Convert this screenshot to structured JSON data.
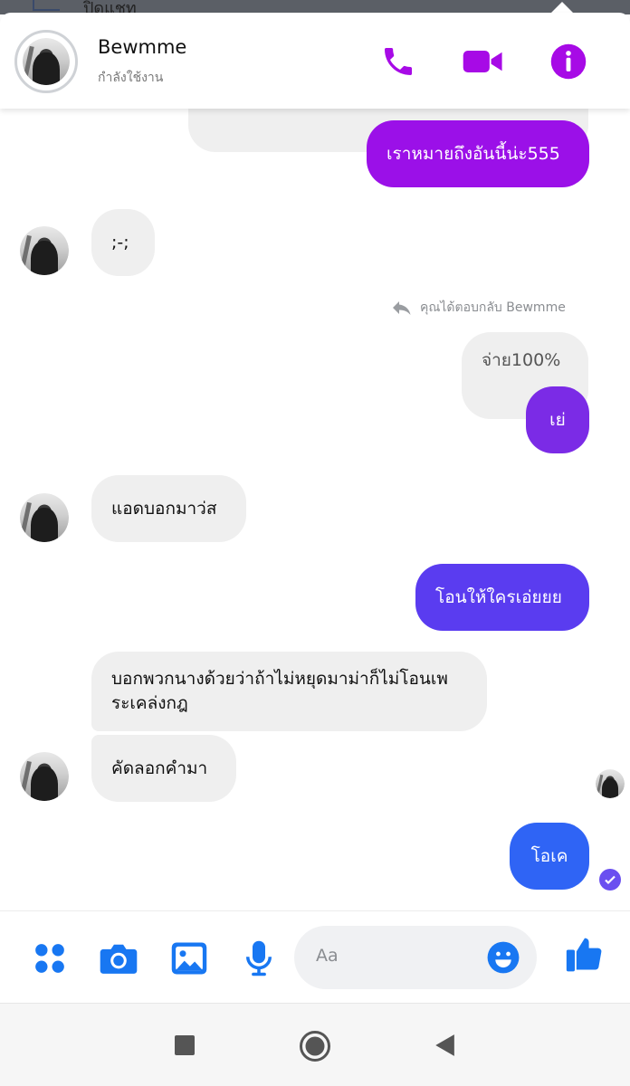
{
  "background": {
    "peek_text": "ปิดแชท"
  },
  "header": {
    "name": "Bewmme",
    "status": "กำลังใช้งาน",
    "accent": "#a70ae6",
    "actions": [
      "phone-icon",
      "video-icon",
      "info-icon"
    ]
  },
  "messages": [
    {
      "id": "m0",
      "side": "out",
      "text": "เราหมายถึงอันนี้น่ะ555",
      "color": "#9b10e8"
    },
    {
      "id": "m1",
      "side": "in",
      "text": ";-;"
    },
    {
      "id": "m2",
      "side": "in-reply",
      "text": "จ่าย100%"
    },
    {
      "id": "m3",
      "side": "out",
      "text": "เย่",
      "color": "#7b2be6"
    },
    {
      "id": "m4",
      "side": "in",
      "text": "แอดบอกมาว่ส"
    },
    {
      "id": "m5",
      "side": "out",
      "text": "โอนให้ใครเอ่ยยย",
      "color": "#5a3cf0"
    },
    {
      "id": "m6",
      "side": "in",
      "text_line1": "บอกพวกนางด้วยว่าถ้าไม่หยุดมาม่าก็ไม่โอนเพ",
      "text_line2": "ระเคล่งกฎ"
    },
    {
      "id": "m7",
      "side": "in",
      "text": "คัดลอกคำมา"
    },
    {
      "id": "m8",
      "side": "out",
      "text": "โอเค",
      "color": "#2f64f5"
    }
  ],
  "reply_note": {
    "text": "คุณได้ตอบกลับ Bewmme"
  },
  "composer": {
    "placeholder": "Aa",
    "accent": "#1877f2",
    "icons": [
      "apps-icon",
      "camera-icon",
      "gallery-icon",
      "microphone-icon",
      "emoji-icon",
      "like-icon"
    ]
  },
  "navbar": {
    "icons": [
      "recent-apps-icon",
      "home-icon",
      "back-icon"
    ]
  }
}
